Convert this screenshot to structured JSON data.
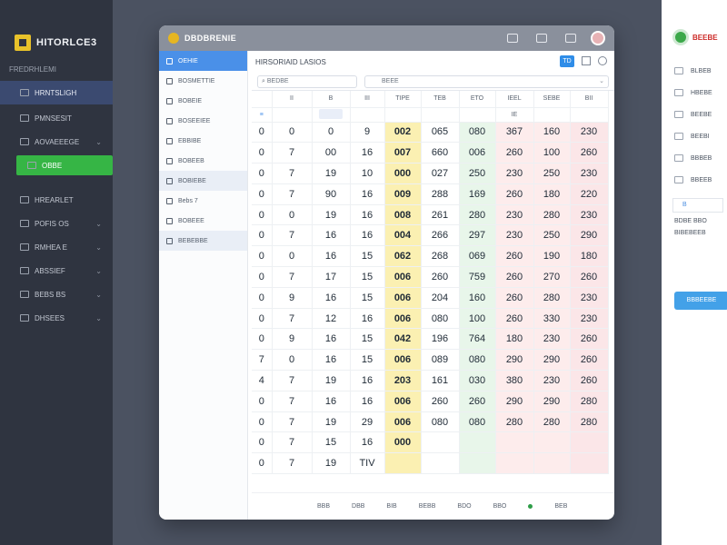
{
  "sidebar": {
    "brand": "HITORLCE3",
    "caption": "FREDRHLEMI",
    "items": [
      {
        "label": "HRNTSLIGH",
        "state": "active",
        "chevron": ""
      },
      {
        "label": "PMNSESIT",
        "state": "",
        "chevron": ""
      },
      {
        "label": "AOVAEEEGE",
        "state": "",
        "chevron": "⌄"
      },
      {
        "label": "OBBE",
        "state": "green",
        "chevron": ""
      },
      {
        "label": "HREARLET",
        "state": "",
        "chevron": ""
      },
      {
        "label": "POFIS OS",
        "state": "",
        "chevron": "⌄"
      },
      {
        "label": "RMHEA E",
        "state": "",
        "chevron": "⌄"
      },
      {
        "label": "ABSSIEF",
        "state": "",
        "chevron": "⌄"
      },
      {
        "label": "BEBS BS",
        "state": "",
        "chevron": "⌄"
      },
      {
        "label": "DHSEES",
        "state": "",
        "chevron": "⌄"
      }
    ],
    "accent_green": "#36b545",
    "active_bg": "#3b4a70"
  },
  "window": {
    "title": "DBDBRENIE",
    "inner_nav": [
      {
        "label": "OEHIE",
        "state": "selected"
      },
      {
        "label": "BOSMETTIE",
        "state": ""
      },
      {
        "label": "BOBEIE",
        "state": ""
      },
      {
        "label": "BOSEEIEE",
        "state": ""
      },
      {
        "label": "EBBIBE",
        "state": ""
      },
      {
        "label": "BOBEEB",
        "state": ""
      },
      {
        "label": "BOBIEBE",
        "state": "shade"
      },
      {
        "label": "Bebs   7",
        "state": ""
      },
      {
        "label": "BOBEEE",
        "state": ""
      },
      {
        "label": "BEBEBBE",
        "state": "shade"
      }
    ],
    "page_title": "HIRSORIAID LASIOS",
    "search_placeholder": "BEDBE",
    "select_value": "BEEE",
    "head_button": "TD"
  },
  "table": {
    "headers": [
      "",
      "",
      "II",
      "B",
      "III",
      "TIPE",
      "TEB",
      "ETO",
      "IEEL",
      "SEBE",
      "BII"
    ],
    "subheader": [
      "",
      "",
      "",
      "",
      "",
      "",
      "",
      "",
      "IE",
      "",
      ""
    ],
    "rows": [
      [
        "0",
        "0",
        "0",
        "9",
        "002",
        "065",
        "080",
        "367",
        "160",
        "230"
      ],
      [
        "0",
        "7",
        "00",
        "16",
        "007",
        "660",
        "006",
        "260",
        "100",
        "260"
      ],
      [
        "0",
        "7",
        "19",
        "10",
        "000",
        "027",
        "250",
        "230",
        "250",
        "230"
      ],
      [
        "0",
        "7",
        "90",
        "16",
        "009",
        "288",
        "169",
        "260",
        "180",
        "220"
      ],
      [
        "0",
        "0",
        "19",
        "16",
        "008",
        "261",
        "280",
        "230",
        "280",
        "230"
      ],
      [
        "0",
        "7",
        "16",
        "16",
        "004",
        "266",
        "297",
        "230",
        "250",
        "290"
      ],
      [
        "0",
        "0",
        "16",
        "15",
        "062",
        "268",
        "069",
        "260",
        "190",
        "180"
      ],
      [
        "0",
        "7",
        "17",
        "15",
        "006",
        "260",
        "759",
        "260",
        "270",
        "260"
      ],
      [
        "0",
        "9",
        "16",
        "15",
        "006",
        "204",
        "160",
        "260",
        "280",
        "230"
      ],
      [
        "0",
        "7",
        "12",
        "16",
        "006",
        "080",
        "100",
        "260",
        "330",
        "230"
      ],
      [
        "0",
        "9",
        "16",
        "15",
        "042",
        "196",
        "764",
        "180",
        "230",
        "260"
      ],
      [
        "7",
        "0",
        "16",
        "15",
        "006",
        "089",
        "080",
        "290",
        "290",
        "260"
      ],
      [
        "4",
        "7",
        "19",
        "16",
        "203",
        "161",
        "030",
        "380",
        "230",
        "260"
      ],
      [
        "0",
        "7",
        "16",
        "16",
        "006",
        "260",
        "260",
        "290",
        "290",
        "280"
      ],
      [
        "0",
        "7",
        "19",
        "29",
        "006",
        "080",
        "080",
        "280",
        "280",
        "280"
      ],
      [
        "0",
        "7",
        "15",
        "16",
        "000",
        "",
        "",
        "",
        "",
        ""
      ],
      [
        "0",
        "7",
        "19",
        "TIV",
        "",
        "",
        "",
        "",
        "",
        ""
      ]
    ],
    "footer": [
      "BBB",
      "DBB",
      "BIB",
      "BEBB",
      "BDO",
      "BBO",
      "BEB"
    ],
    "colors": {
      "yellow": "#fbf0b2",
      "green": "#e8f6ea",
      "pink": "#fdecec",
      "red_text": "#d43a2f"
    }
  },
  "right_panel": {
    "brand": "BEEBE",
    "items": [
      "BLBEB",
      "HBEBE",
      "BEEBE",
      "BEEBI",
      "BBBEB",
      "BBEEB"
    ],
    "field_value": "B",
    "label_1": "BDBE BBO",
    "label_2": "BIBEBEEB",
    "button": "BBBEEBE"
  }
}
